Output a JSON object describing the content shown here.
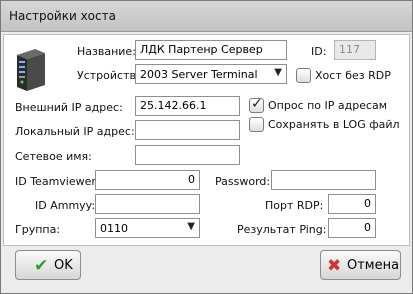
{
  "window": {
    "title": "Настройки хоста"
  },
  "form": {
    "name_label": "Название:",
    "name_value": "ЛДК Партенр Сервер",
    "id_label": "ID:",
    "id_value": "117",
    "device_label": "Устройство:",
    "device_value": "2003 Server Terminal",
    "host_no_rdp_label": "Хост без RDP",
    "host_no_rdp_checked": false,
    "external_ip_label": "Внешний IP адрес:",
    "external_ip_value": "25.142.66.1",
    "poll_ip_label": "Опрос по IP адресам",
    "poll_ip_checked": true,
    "local_ip_label": "Локальный IP адрес:",
    "local_ip_value": "",
    "save_log_label": "Сохранять в LOG файл",
    "save_log_checked": false,
    "network_name_label": "Сетевое имя:",
    "network_name_value": "",
    "teamviewer_label": "ID Teamviewer:",
    "teamviewer_value": "0",
    "password_label": "Password:",
    "password_value": "",
    "ammyy_label": "ID Ammyy:",
    "ammyy_value": "",
    "rdp_port_label": "Порт RDP:",
    "rdp_port_value": "0",
    "group_label": "Группа:",
    "group_value": "0110",
    "ping_result_label": "Результат Ping:",
    "ping_result_value": "0"
  },
  "buttons": {
    "ok_label": "OK",
    "cancel_label": "Отмена"
  },
  "icons": {
    "server": "server-icon",
    "ok": "checkmark-icon",
    "cancel": "close-x-icon",
    "dropdown": "chevron-down-icon"
  },
  "colors": {
    "ok_icon": "#2f9e2f",
    "cancel_icon": "#d03434",
    "panel": "#ffffff",
    "window": "#ececec"
  }
}
